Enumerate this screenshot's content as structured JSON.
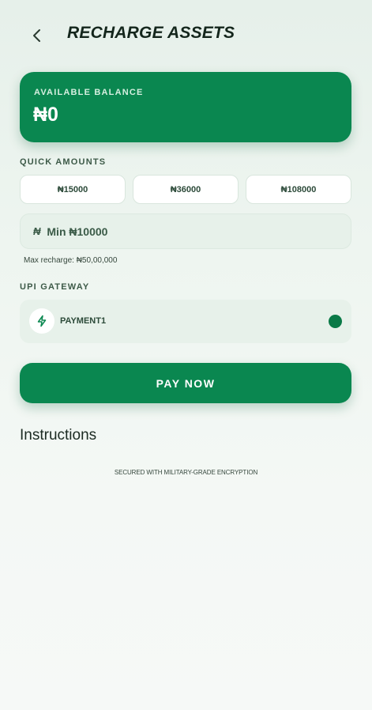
{
  "header": {
    "back_icon": "chevron-left-icon",
    "title": "RECHARGE ASSETS"
  },
  "balance": {
    "label": "AVAILABLE BALANCE",
    "value": "₦0"
  },
  "quick_amounts": {
    "label": "QUICK AMOUNTS",
    "options": [
      "₦15000",
      "₦36000",
      "₦108000"
    ]
  },
  "amount_field": {
    "currency_symbol": "₦",
    "placeholder": "Min ₦10000",
    "value": ""
  },
  "max_recharge": "Max recharge: ₦50,00,000",
  "gateway": {
    "label": "UPI GATEWAY",
    "icon": "lightning-icon",
    "name": "PAYMENT1",
    "selected": true
  },
  "pay_button": "PAY NOW",
  "instructions_title": "Instructions",
  "security_note": "SECURED WITH MILITARY-GRADE ENCRYPTION",
  "colors": {
    "primary": "#0a8750",
    "background": "#eef5f0",
    "card_tint": "#e7f1ea",
    "text_dark": "#14261c"
  }
}
